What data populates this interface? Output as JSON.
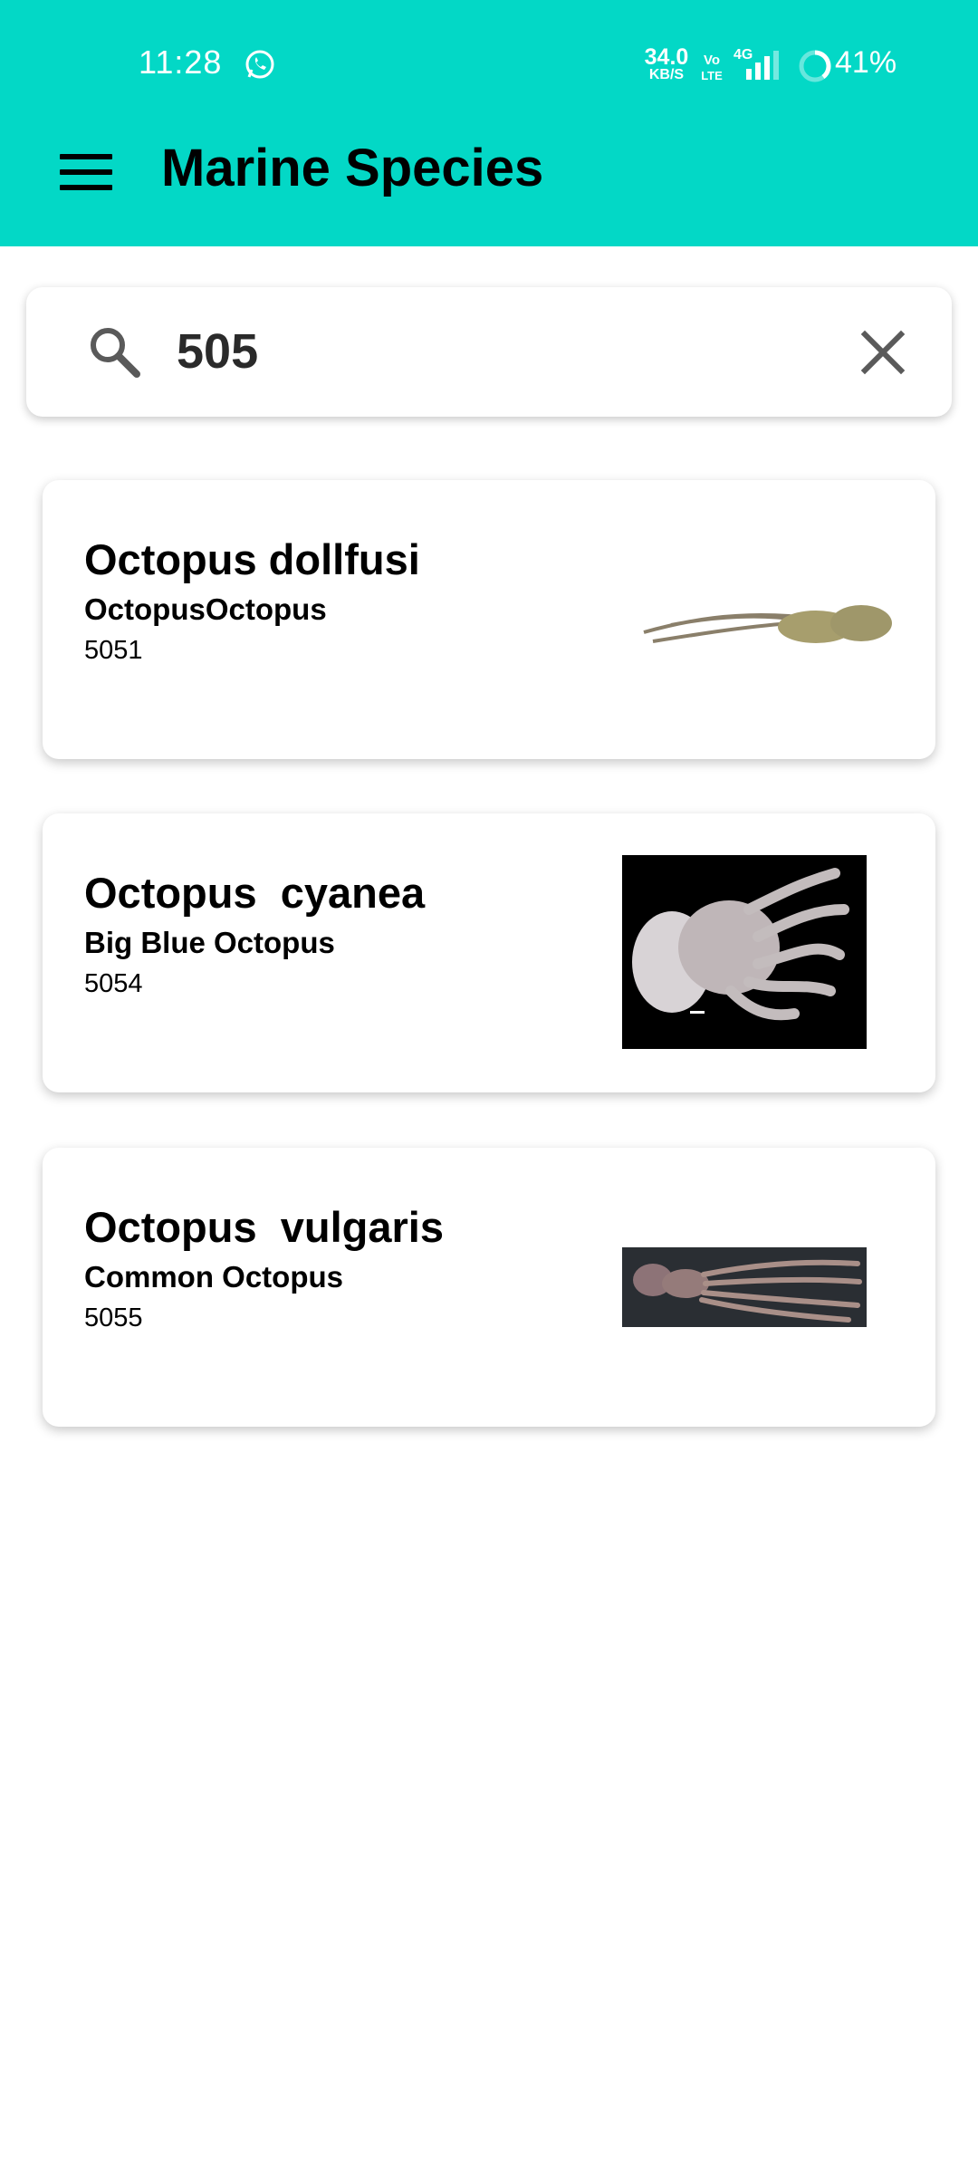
{
  "status_bar": {
    "time": "11:28",
    "speed_value": "34.0",
    "speed_unit": "KB/S",
    "volte_top": "Vo",
    "volte_bottom": "LTE",
    "network": "4G",
    "battery": "41%",
    "icons": [
      "whatsapp-icon",
      "signal-icon",
      "battery-icon"
    ]
  },
  "app_bar": {
    "title": "Marine Species",
    "menu_icon": "hamburger-menu-icon",
    "color": "#03d8c6"
  },
  "search": {
    "value": "505",
    "search_icon": "search-icon",
    "clear_icon": "close-icon"
  },
  "results": [
    {
      "name": "Octopus dollfusi",
      "common_name": "OctopusOctopus",
      "code": "5051",
      "image": "octopus-dollfusi-photo"
    },
    {
      "name": "Octopus  cyanea",
      "common_name": "Big Blue Octopus",
      "code": "5054",
      "image": "octopus-cyanea-photo"
    },
    {
      "name": "Octopus  vulgaris",
      "common_name": "Common Octopus",
      "code": "5055",
      "image": "octopus-vulgaris-photo"
    }
  ]
}
